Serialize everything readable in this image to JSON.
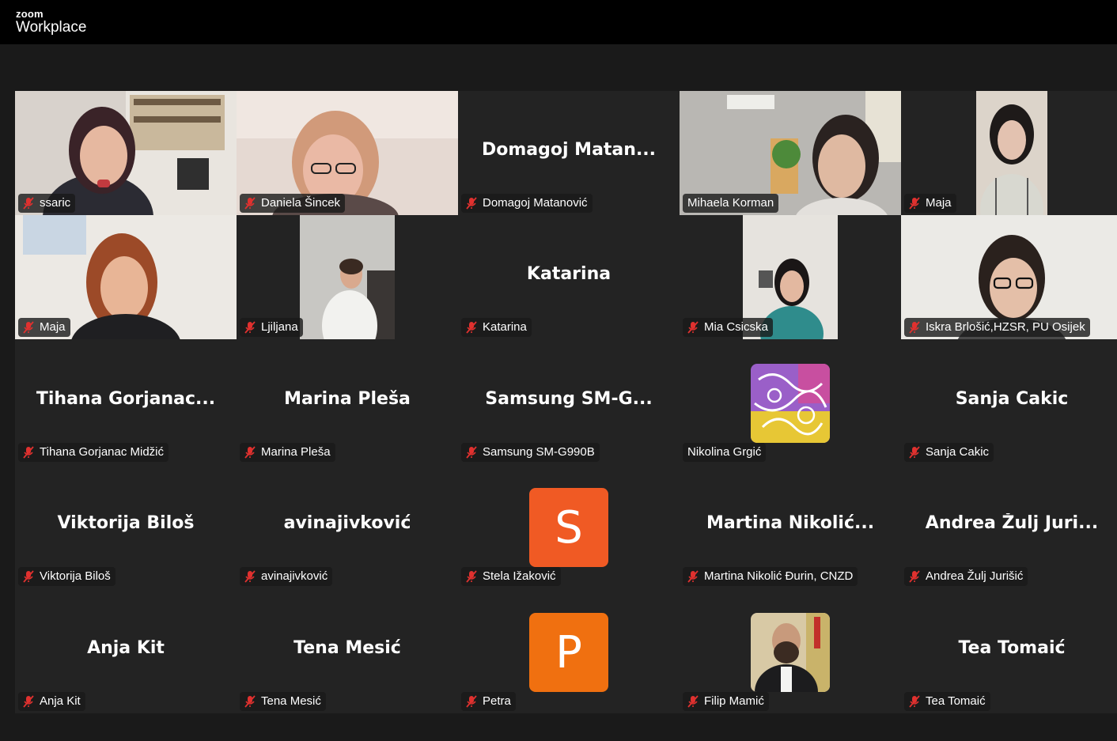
{
  "app": {
    "brand_top": "zoom",
    "brand_bottom": "Workplace"
  },
  "colors": {
    "active_speaker_border": "#2fe38a",
    "muted_icon": "#e0312f",
    "tile_bg": "#232323",
    "avatar_s": "#f05a24",
    "avatar_p": "#f07010"
  },
  "participants": [
    {
      "name": "ssaric",
      "muted": true
    },
    {
      "name": "Daniela Šincek",
      "muted": true
    },
    {
      "name": "Domagoj Matanović",
      "display": "Domagoj  Matan...",
      "muted": true
    },
    {
      "name": "Mihaela Korman",
      "muted": false,
      "active": true
    },
    {
      "name": "Maja",
      "muted": true
    },
    {
      "name": "Maja",
      "muted": true
    },
    {
      "name": "Ljiljana",
      "muted": true
    },
    {
      "name": "Katarina",
      "display": "Katarina",
      "muted": true
    },
    {
      "name": "Mia Csicska",
      "muted": true
    },
    {
      "name": "Iskra Brlošić,HZSR, PU Osijek",
      "muted": true
    },
    {
      "name": "Tihana Gorjanac Midžić",
      "display": "Tihana  Gorjanac...",
      "muted": true
    },
    {
      "name": "Marina Pleša",
      "display": "Marina Pleša",
      "muted": true
    },
    {
      "name": "Samsung SM-G990B",
      "display": "Samsung  SM-G...",
      "muted": true
    },
    {
      "name": "Nikolina Grgić",
      "muted": false,
      "avatar": "pattern-image"
    },
    {
      "name": "Sanja Cakic",
      "display": "Sanja Cakic",
      "muted": true
    },
    {
      "name": "Viktorija Biloš",
      "display": "Viktorija Biloš",
      "muted": true
    },
    {
      "name": "avinajivković",
      "display": "avinajivković",
      "muted": true
    },
    {
      "name": "Stela Ižaković",
      "muted": true,
      "avatar_letter": "S"
    },
    {
      "name": "Martina Nikolić Đurin, CNZD",
      "display": "Martina  Nikolić...",
      "muted": true
    },
    {
      "name": "Andrea Žulj Jurišić",
      "display": "Andrea Žulj Juri...",
      "muted": true
    },
    {
      "name": "Anja Kit",
      "display": "Anja Kit",
      "muted": true
    },
    {
      "name": "Tena Mesić",
      "display": "Tena Mesić",
      "muted": true
    },
    {
      "name": "Petra",
      "muted": true,
      "avatar_letter": "P"
    },
    {
      "name": "Filip Mamić",
      "muted": true,
      "avatar": "photo"
    },
    {
      "name": "Tea Tomaić",
      "display": "Tea Tomaić",
      "muted": true
    }
  ]
}
